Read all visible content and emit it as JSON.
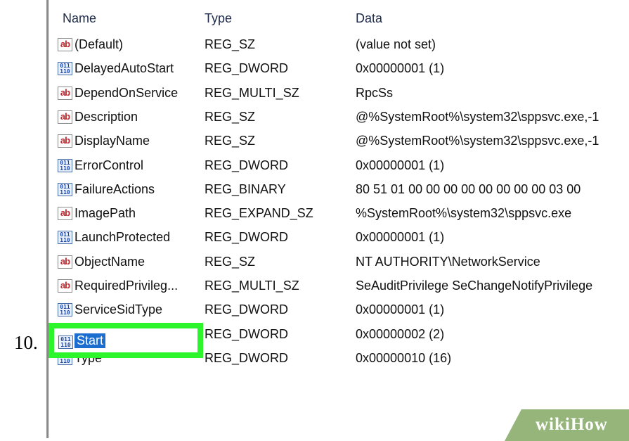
{
  "step": {
    "number": "10."
  },
  "columns": {
    "name": "Name",
    "type": "Type",
    "data": "Data"
  },
  "rows": [
    {
      "name": "(Default)",
      "type": "REG_SZ",
      "data": "(value not set)",
      "icon": "string-value-icon"
    },
    {
      "name": "DelayedAutoStart",
      "type": "REG_DWORD",
      "data": "0x00000001 (1)",
      "icon": "binary-value-icon"
    },
    {
      "name": "DependOnService",
      "type": "REG_MULTI_SZ",
      "data": "RpcSs",
      "icon": "string-value-icon"
    },
    {
      "name": "Description",
      "type": "REG_SZ",
      "data": "@%SystemRoot%\\system32\\sppsvc.exe,-1",
      "icon": "string-value-icon"
    },
    {
      "name": "DisplayName",
      "type": "REG_SZ",
      "data": "@%SystemRoot%\\system32\\sppsvc.exe,-1",
      "icon": "string-value-icon"
    },
    {
      "name": "ErrorControl",
      "type": "REG_DWORD",
      "data": "0x00000001 (1)",
      "icon": "binary-value-icon"
    },
    {
      "name": "FailureActions",
      "type": "REG_BINARY",
      "data": "80 51 01 00 00 00 00 00 00 00 00 03 00",
      "icon": "binary-value-icon"
    },
    {
      "name": "ImagePath",
      "type": "REG_EXPAND_SZ",
      "data": "%SystemRoot%\\system32\\sppsvc.exe",
      "icon": "string-value-icon"
    },
    {
      "name": "LaunchProtected",
      "type": "REG_DWORD",
      "data": "0x00000001 (1)",
      "icon": "binary-value-icon"
    },
    {
      "name": "ObjectName",
      "type": "REG_SZ",
      "data": "NT AUTHORITY\\NetworkService",
      "icon": "string-value-icon"
    },
    {
      "name": "RequiredPrivileg...",
      "type": "REG_MULTI_SZ",
      "data": "SeAuditPrivilege SeChangeNotifyPrivilege",
      "icon": "string-value-icon"
    },
    {
      "name": "ServiceSidType",
      "type": "REG_DWORD",
      "data": "0x00000001 (1)",
      "icon": "binary-value-icon"
    },
    {
      "name": "Start",
      "type": "REG_DWORD",
      "data": "0x00000002 (2)",
      "icon": "binary-value-icon",
      "selected": true
    },
    {
      "name": "Type",
      "type": "REG_DWORD",
      "data": "0x00000010 (16)",
      "icon": "binary-value-icon"
    }
  ],
  "rename": {
    "value": "Start"
  },
  "watermark": {
    "text_a": "wiki",
    "text_b": "How"
  },
  "colors": {
    "highlight_box": "#2cf52c",
    "selection": "#1c6dd0",
    "watermark_bg": "#95b57a"
  }
}
